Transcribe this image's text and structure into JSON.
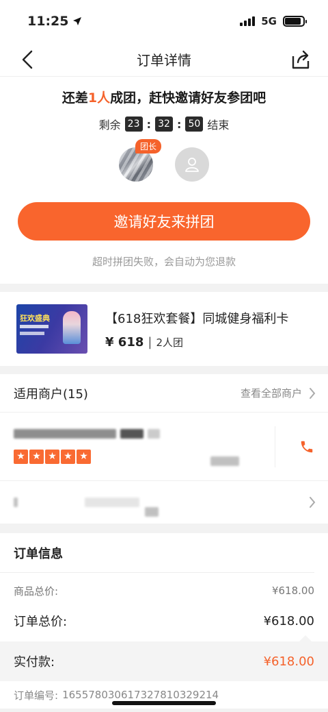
{
  "status_bar": {
    "time": "11:25",
    "network": "5G",
    "battery_level": 0.9
  },
  "nav": {
    "title": "订单详情"
  },
  "group": {
    "headline_before": "还差",
    "headline_highlight": "1人",
    "headline_after": "成团，赶快邀请好友参团吧",
    "remaining_label": "剩余",
    "hours": "23",
    "minutes": "32",
    "seconds": "50",
    "end_label": "结束",
    "leader_badge": "团长",
    "invite_button": "邀请好友来拼团",
    "timeout_note": "超时拼团失败，会自动为您退款"
  },
  "product": {
    "thumb_text": "狂欢盛典",
    "name": "【618狂欢套餐】同城健身福利卡",
    "price": "¥ 618",
    "group_size": "2人团"
  },
  "merchants": {
    "title": "适用商户(15)",
    "view_all": "查看全部商户",
    "rating_stars": 5,
    "star_glyph": "★"
  },
  "order": {
    "title": "订单信息",
    "subtotal_label": "商品总价:",
    "subtotal_value": "¥618.00",
    "total_label": "订单总价:",
    "total_value": "¥618.00",
    "paid_label": "实付款:",
    "paid_value": "¥618.00",
    "order_no_label": "订单编号:",
    "order_no_value": "165578030617327810329214"
  },
  "colors": {
    "accent": "#f9652d",
    "text": "#222222",
    "muted": "#999999"
  }
}
